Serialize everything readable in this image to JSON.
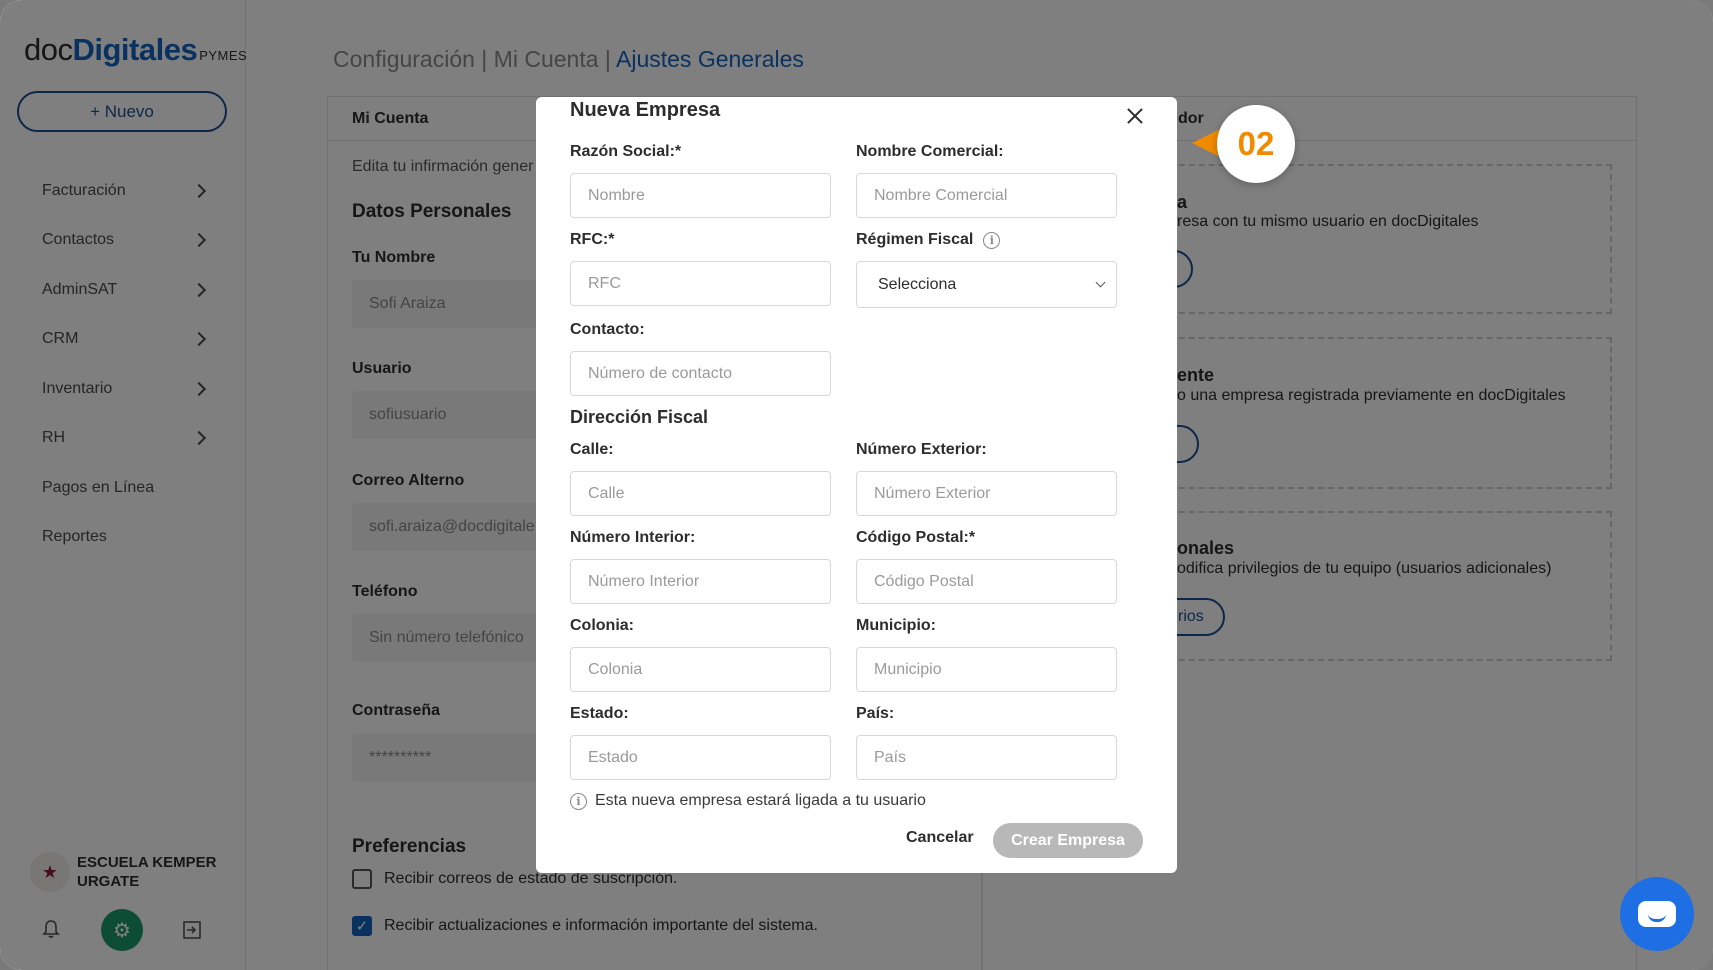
{
  "sidebar": {
    "logo": {
      "prefix": "doc",
      "brand": "Digitales",
      "suffix": "PYMES"
    },
    "new_button": "+ Nuevo",
    "items": [
      {
        "label": "Facturación",
        "has_submenu": true
      },
      {
        "label": "Contactos",
        "has_submenu": true
      },
      {
        "label": "AdminSAT",
        "has_submenu": true
      },
      {
        "label": "CRM",
        "has_submenu": true
      },
      {
        "label": "Inventario",
        "has_submenu": true
      },
      {
        "label": "RH",
        "has_submenu": true
      },
      {
        "label": "Pagos en Línea",
        "has_submenu": false
      },
      {
        "label": "Reportes",
        "has_submenu": false
      }
    ],
    "user": {
      "line1": "ESCUELA KEMPER",
      "line2": "URGATE"
    },
    "bottom_icons": [
      "bell-icon",
      "gear-icon",
      "logout-icon"
    ]
  },
  "breadcrumb": {
    "part1": "Configuración | Mi Cuenta | ",
    "active": "Ajustes Generales"
  },
  "left_card": {
    "header": "Mi Cuenta",
    "intro": "Edita tu infirmación gener",
    "section_title": "Datos Personales",
    "fields": [
      {
        "label": "Tu Nombre",
        "value": "Sofi Araiza"
      },
      {
        "label": "Usuario",
        "value": "sofiusuario"
      },
      {
        "label": "Correo Alterno",
        "value": "sofi.araiza@docdigitale"
      },
      {
        "label": "Teléfono",
        "value": "Sin número telefónico"
      },
      {
        "label": "Contraseña",
        "value": "**********"
      }
    ],
    "preferences_title": "Preferencias",
    "preferences": [
      {
        "label": "Recibir correos de estado de suscripción.",
        "checked": false
      },
      {
        "label": "Recibir actualizaciones e información importante del sistema.",
        "checked": true
      }
    ]
  },
  "right_card": {
    "header_fragment": "dor",
    "options": [
      {
        "title_fragment": "a",
        "desc_fragment": "resa con tu mismo usuario en docDigitales",
        "button_fragment": ""
      },
      {
        "title_fragment": "ente",
        "desc_fragment": "o una empresa registrada previamente en docDigitales",
        "button_fragment": ""
      },
      {
        "title_fragment": "onales",
        "desc_fragment": "odifica privilegios de tu equipo (usuarios adicionales)",
        "button_fragment": "rios"
      }
    ]
  },
  "modal": {
    "title": "Nueva Empresa",
    "close_icon": "close-icon",
    "razon_social": {
      "label": "Razón Social:*",
      "placeholder": "Nombre"
    },
    "nombre_comercial": {
      "label": "Nombre Comercial:",
      "placeholder": "Nombre Comercial"
    },
    "rfc": {
      "label": "RFC:*",
      "placeholder": "RFC"
    },
    "regimen_fiscal": {
      "label": "Régimen Fiscal",
      "selected": "Selecciona"
    },
    "contacto": {
      "label": "Contacto:",
      "placeholder": "Número de contacto"
    },
    "direccion_title": "Dirección Fiscal",
    "calle": {
      "label": "Calle:",
      "placeholder": "Calle"
    },
    "numero_exterior": {
      "label": "Número Exterior:",
      "placeholder": "Número Exterior"
    },
    "numero_interior": {
      "label": "Número Interior:",
      "placeholder": "Número Interior"
    },
    "codigo_postal": {
      "label": "Código Postal:*",
      "placeholder": "Código Postal"
    },
    "colonia": {
      "label": "Colonia:",
      "placeholder": "Colonia"
    },
    "municipio": {
      "label": "Municipio:",
      "placeholder": "Municipio"
    },
    "estado": {
      "label": "Estado:",
      "placeholder": "Estado"
    },
    "pais": {
      "label": "País:",
      "placeholder": "País"
    },
    "note": "Esta nueva empresa estará ligada a tu usuario",
    "cancel": "Cancelar",
    "create": "Crear Empresa"
  },
  "callout": {
    "step": "02",
    "color": "#f08a00"
  },
  "colors": {
    "brand": "#1565c0",
    "accent_green": "#1c9b6a",
    "chat_blue": "#1d6fe3"
  }
}
